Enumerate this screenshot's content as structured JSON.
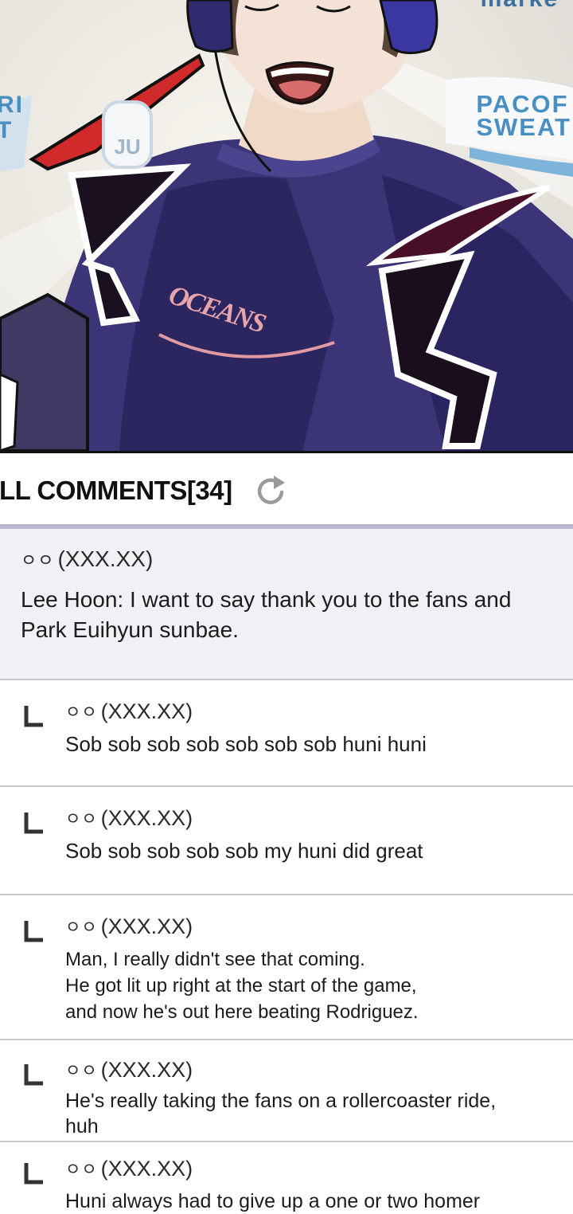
{
  "panel": {
    "sign_left": "RI\nT",
    "sign_right_line1": "PACOF",
    "sign_right_line2": "SWEAT",
    "sign_top": "marke",
    "badge_text": "JU",
    "shirt_logo": "OCEANS"
  },
  "comments": {
    "title": "LL COMMENTS[34]",
    "refresh_icon": "refresh-icon",
    "main": {
      "author": "ㅇㅇ",
      "ip": "(XXX.XX)",
      "text": "Lee Hoon: I want to say thank you to the fans and Park Euihyun sunbae."
    },
    "replies": [
      {
        "author": "ㅇㅇ",
        "ip": "(XXX.XX)",
        "text": "Sob sob sob sob sob sob sob huni huni"
      },
      {
        "author": "ㅇㅇ",
        "ip": "(XXX.XX)",
        "text": "Sob sob sob sob sob my huni did great"
      },
      {
        "author": "ㅇㅇ",
        "ip": "(XXX.XX)",
        "text": "Man, I really didn't see that coming.\nHe got lit up right at the start of the game,\nand now he's out here beating Rodriguez."
      },
      {
        "author": "ㅇㅇ",
        "ip": "(XXX.XX)",
        "text": "He's really taking the fans on a rollercoaster ride,\nhuh"
      },
      {
        "author": "ㅇㅇ",
        "ip": "(XXX.XX)",
        "text": "Huni always had to give up a one or two homer"
      }
    ]
  }
}
